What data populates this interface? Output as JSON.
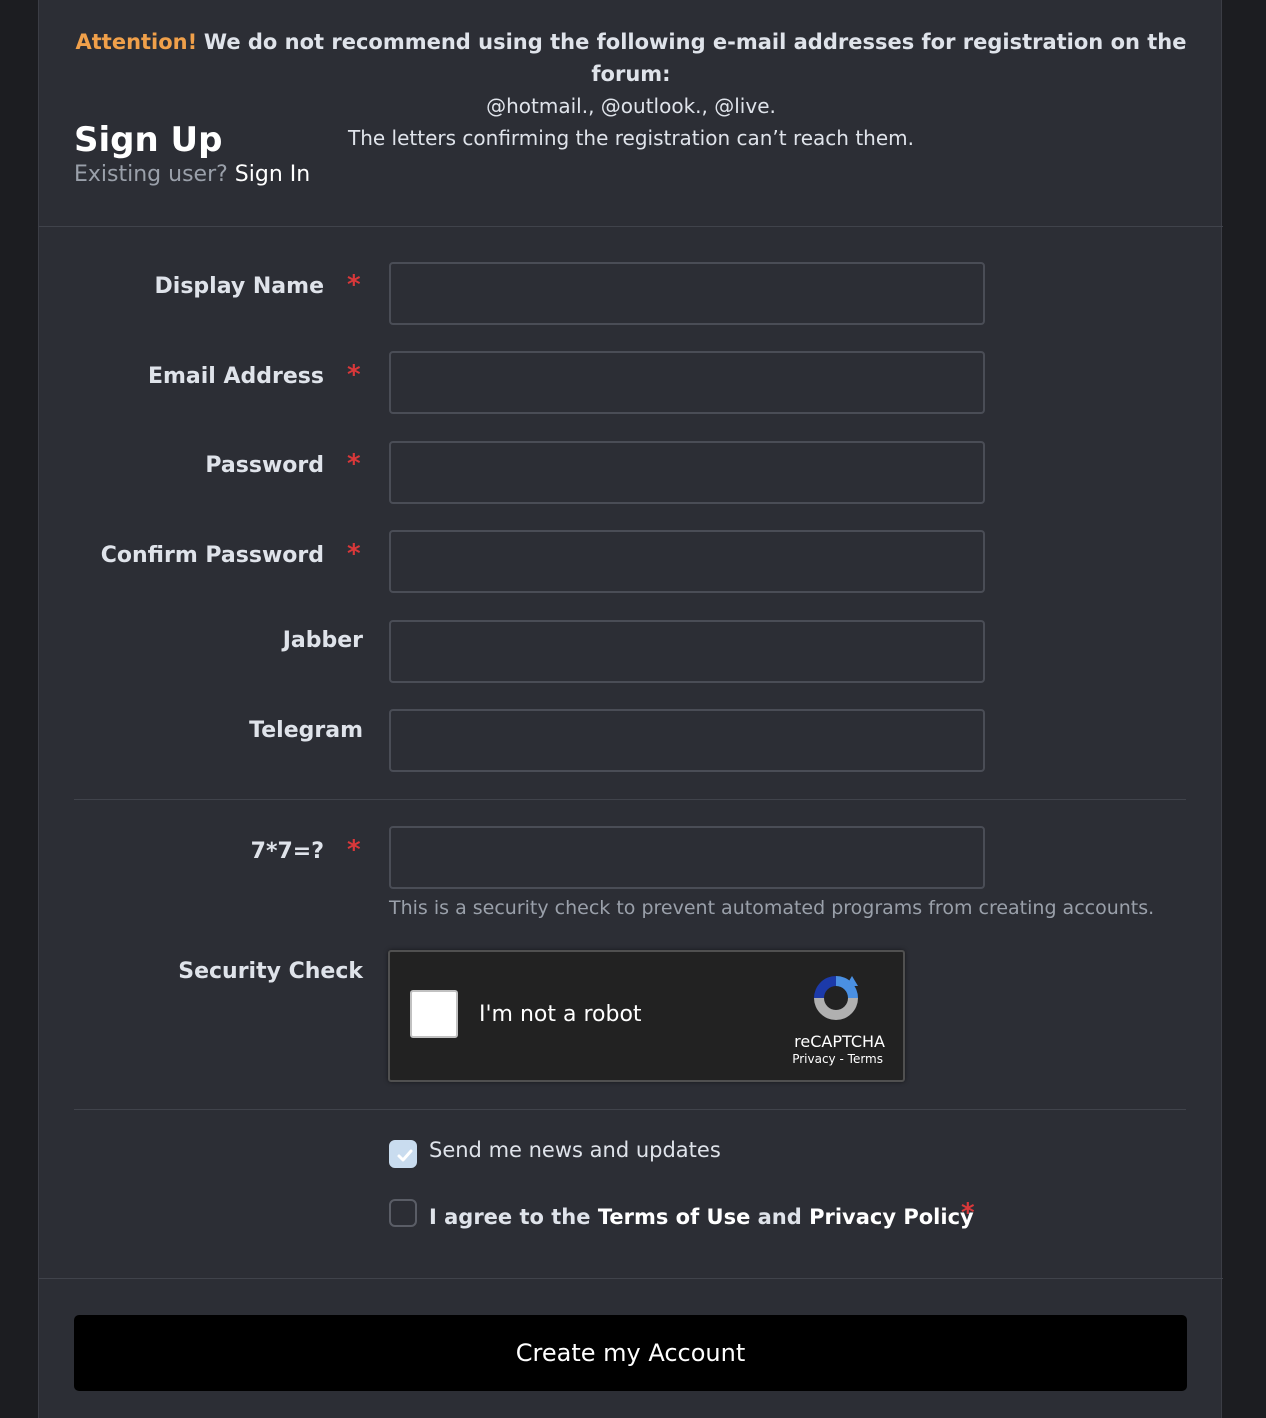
{
  "notice": {
    "attention": "Attention!",
    "message": "We do not recommend using the following e-mail addresses for registration on the forum:",
    "domains": "@hotmail., @outlook., @live.",
    "reason": "The letters confirming the registration can’t reach them."
  },
  "header": {
    "title": "Sign Up",
    "existing_user": "Existing user?",
    "sign_in": "Sign In"
  },
  "form": {
    "required_mark": "*",
    "fields": [
      {
        "label": "Display Name",
        "required": true,
        "value": ""
      },
      {
        "label": "Email Address",
        "required": true,
        "value": ""
      },
      {
        "label": "Password",
        "required": true,
        "value": ""
      },
      {
        "label": "Confirm Password",
        "required": true,
        "value": ""
      },
      {
        "label": "Jabber",
        "required": false,
        "value": ""
      },
      {
        "label": "Telegram",
        "required": false,
        "value": ""
      }
    ],
    "question": {
      "label": "7*7=?",
      "required": true,
      "value": "",
      "help": "This is a security check to prevent automated programs from creating accounts."
    },
    "security_check": {
      "label": "Security Check",
      "captcha_text": "I'm not a robot",
      "brand": "reCAPTCHA",
      "privacy": "Privacy",
      "separator": "-",
      "terms": "Terms"
    },
    "news": {
      "label": "Send me news and updates",
      "checked": true
    },
    "agree": {
      "prefix": "I agree to the",
      "terms": "Terms of Use",
      "and": "and",
      "privacy": "Privacy Policy",
      "checked": false
    }
  },
  "submit": {
    "label": "Create my Account"
  },
  "colors": {
    "accent": "#f0a04a",
    "required": "#d9383a",
    "panel": "#2c2e35",
    "button": "#000000"
  }
}
